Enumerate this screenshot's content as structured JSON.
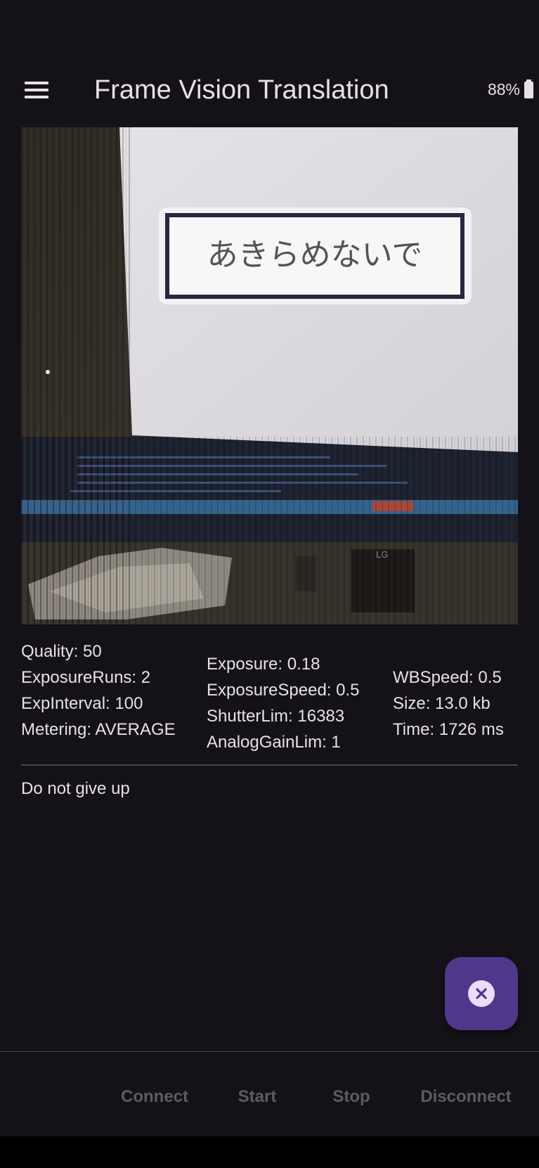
{
  "app_bar": {
    "menu_icon": "hamburger-menu-icon",
    "title": "Frame Vision Translation",
    "battery_text": "88%",
    "battery_icon": "battery-icon"
  },
  "camera": {
    "sign_text": "あきらめないで",
    "brand_text": "LG"
  },
  "stats": {
    "col1": [
      "Quality: 50",
      "ExposureRuns: 2",
      "ExpInterval: 100",
      "Metering: AVERAGE"
    ],
    "col2": [
      "Exposure: 0.18",
      "ExposureSpeed: 0.5",
      "ShutterLim: 16383",
      "AnalogGainLim: 1"
    ],
    "col3": [
      "WBSpeed: 0.5",
      "Size: 13.0 kb",
      "Time: 1726 ms"
    ]
  },
  "result_text": "Do not give up",
  "fab": {
    "icon": "cancel-icon"
  },
  "bottom_bar": {
    "connect_label": "Connect",
    "start_label": "Start",
    "stop_label": "Stop",
    "disconnect_label": "Disconnect"
  },
  "colors": {
    "background": "#141218",
    "fab": "#4f378b",
    "text": "#e6e0e9",
    "disabled_text": "#5d5a62"
  }
}
